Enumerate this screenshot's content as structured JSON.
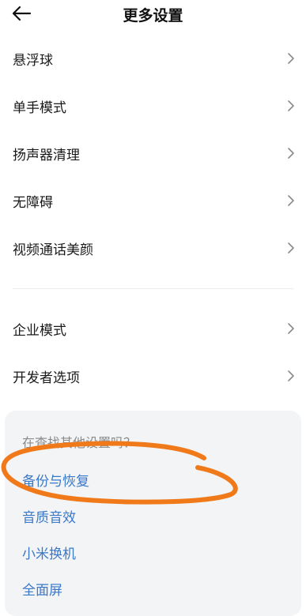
{
  "header": {
    "title": "更多设置",
    "back_icon": "arrow-left-icon"
  },
  "settings": {
    "group1": [
      {
        "label": "悬浮球"
      },
      {
        "label": "单手模式"
      },
      {
        "label": "扬声器清理"
      },
      {
        "label": "无障碍"
      },
      {
        "label": "视频通话美颜"
      }
    ],
    "group2": [
      {
        "label": "企业模式"
      },
      {
        "label": "开发者选项"
      }
    ]
  },
  "suggestions": {
    "title": "在查找其他设置吗？",
    "links": [
      "备份与恢复",
      "音质音效",
      "小米换机",
      "全面屏"
    ]
  },
  "colors": {
    "link": "#3a78c9",
    "annotation": "#f07a1a",
    "card_bg": "#f3f4f6"
  }
}
